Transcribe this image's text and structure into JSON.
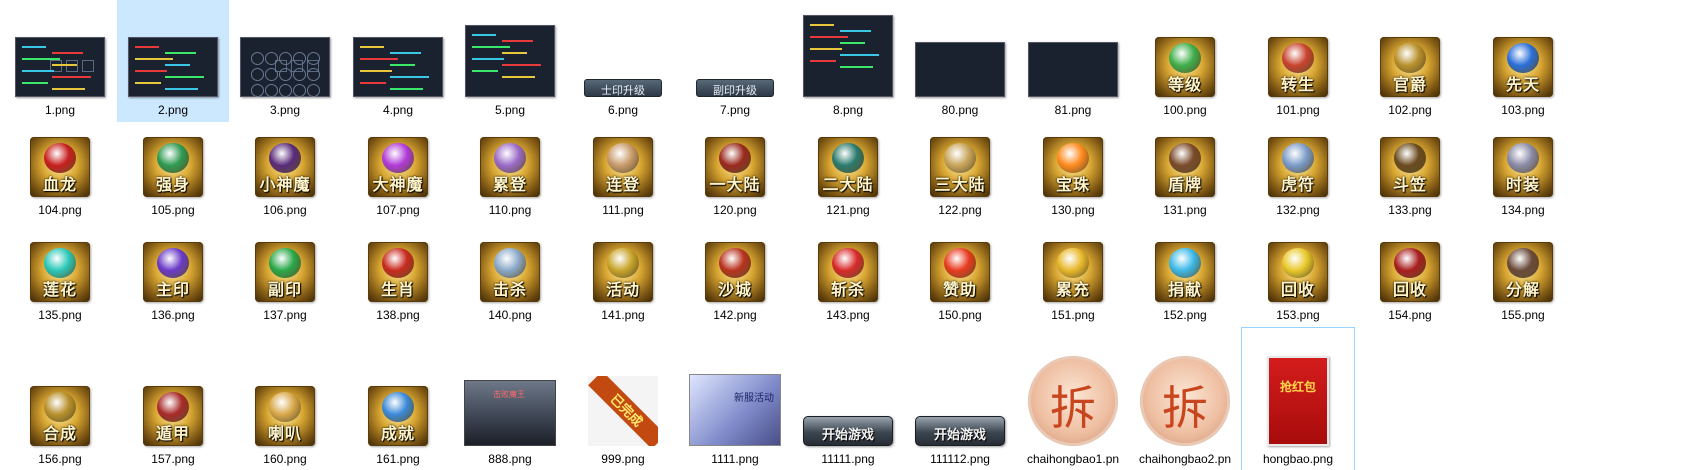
{
  "window": {
    "title": ""
  },
  "files": [
    {
      "name": "1.png",
      "kind": "shot"
    },
    {
      "name": "2.png",
      "kind": "shot",
      "selected": true
    },
    {
      "name": "3.png",
      "kind": "shot"
    },
    {
      "name": "4.png",
      "kind": "shot"
    },
    {
      "name": "5.png",
      "kind": "shot"
    },
    {
      "name": "6.png",
      "kind": "button",
      "text": "士印升级"
    },
    {
      "name": "7.png",
      "kind": "button",
      "text": "副印升级"
    },
    {
      "name": "8.png",
      "kind": "shot"
    },
    {
      "name": "80.png",
      "kind": "shot"
    },
    {
      "name": "81.png",
      "kind": "shot"
    },
    {
      "name": "100.png",
      "kind": "icon",
      "text": "等级",
      "color": "#3fae4a"
    },
    {
      "name": "101.png",
      "kind": "icon",
      "text": "转生",
      "color": "#c8422e"
    },
    {
      "name": "102.png",
      "kind": "icon",
      "text": "官爵",
      "color": "#b8902c"
    },
    {
      "name": "103.png",
      "kind": "icon",
      "text": "先天",
      "color": "#2a6ed8"
    },
    {
      "name": "104.png",
      "kind": "icon",
      "text": "血龙",
      "color": "#c81e1e"
    },
    {
      "name": "105.png",
      "kind": "icon",
      "text": "强身",
      "color": "#2e9a52"
    },
    {
      "name": "106.png",
      "kind": "icon",
      "text": "小神魔",
      "color": "#5a2a7a"
    },
    {
      "name": "107.png",
      "kind": "icon",
      "text": "大神魔",
      "color": "#b03ad8"
    },
    {
      "name": "110.png",
      "kind": "icon",
      "text": "累登",
      "color": "#9a6ac8"
    },
    {
      "name": "111.png",
      "kind": "icon",
      "text": "连登",
      "color": "#c89a6a"
    },
    {
      "name": "120.png",
      "kind": "icon",
      "text": "一大陆",
      "color": "#9a2a1e"
    },
    {
      "name": "121.png",
      "kind": "icon",
      "text": "二大陆",
      "color": "#2a7a6e"
    },
    {
      "name": "122.png",
      "kind": "icon",
      "text": "三大陆",
      "color": "#c8a45a"
    },
    {
      "name": "130.png",
      "kind": "icon",
      "text": "宝珠",
      "color": "#ff8a1e"
    },
    {
      "name": "131.png",
      "kind": "icon",
      "text": "盾牌",
      "color": "#7a4a2a"
    },
    {
      "name": "132.png",
      "kind": "icon",
      "text": "虎符",
      "color": "#7a9ac8"
    },
    {
      "name": "133.png",
      "kind": "icon",
      "text": "斗笠",
      "color": "#6a4a1e"
    },
    {
      "name": "134.png",
      "kind": "icon",
      "text": "时装",
      "color": "#8a8aa8"
    },
    {
      "name": "135.png",
      "kind": "icon",
      "text": "莲花",
      "color": "#2ac8b8"
    },
    {
      "name": "136.png",
      "kind": "icon",
      "text": "主印",
      "color": "#6a3ac8"
    },
    {
      "name": "137.png",
      "kind": "icon",
      "text": "副印",
      "color": "#2aa84a"
    },
    {
      "name": "138.png",
      "kind": "icon",
      "text": "生肖",
      "color": "#c82a1e"
    },
    {
      "name": "140.png",
      "kind": "icon",
      "text": "击杀",
      "color": "#8aa8c8"
    },
    {
      "name": "141.png",
      "kind": "icon",
      "text": "活动",
      "color": "#c8a42a"
    },
    {
      "name": "142.png",
      "kind": "icon",
      "text": "沙城",
      "color": "#b8321e"
    },
    {
      "name": "143.png",
      "kind": "icon",
      "text": "斩杀",
      "color": "#d82a2a"
    },
    {
      "name": "150.png",
      "kind": "icon",
      "text": "赞助",
      "color": "#e83a1e"
    },
    {
      "name": "151.png",
      "kind": "icon",
      "text": "累充",
      "color": "#e8b82a"
    },
    {
      "name": "152.png",
      "kind": "icon",
      "text": "捐献",
      "color": "#3ab8e8"
    },
    {
      "name": "153.png",
      "kind": "icon",
      "text": "回收",
      "color": "#e8c82a"
    },
    {
      "name": "154.png",
      "kind": "icon",
      "text": "回收",
      "color": "#a81e1e"
    },
    {
      "name": "155.png",
      "kind": "icon",
      "text": "分解",
      "color": "#6a4a3a"
    },
    {
      "name": "156.png",
      "kind": "icon",
      "text": "合成",
      "color": "#b8902c"
    },
    {
      "name": "157.png",
      "kind": "icon",
      "text": "遁甲",
      "color": "#a82a2a"
    },
    {
      "name": "160.png",
      "kind": "icon",
      "text": "喇叭",
      "color": "#d8a84a"
    },
    {
      "name": "161.png",
      "kind": "icon",
      "text": "成就",
      "color": "#3a8ad8"
    },
    {
      "name": "888.png",
      "kind": "scene",
      "text": "击败魔王"
    },
    {
      "name": "999.png",
      "kind": "ribbon",
      "text": "已完成"
    },
    {
      "name": "1111.png",
      "kind": "banner",
      "text": "新服活动"
    },
    {
      "name": "11111.png",
      "kind": "gamebtn",
      "text": "开始游戏"
    },
    {
      "name": "111112.png",
      "kind": "gamebtn",
      "text": "开始游戏"
    },
    {
      "name": "chaihongbao1.pn",
      "kind": "disc",
      "text": "拆"
    },
    {
      "name": "chaihongbao2.pn",
      "kind": "disc",
      "text": "拆"
    },
    {
      "name": "hongbao.png",
      "kind": "hongbao",
      "text": "抢红包",
      "hover": true
    }
  ]
}
